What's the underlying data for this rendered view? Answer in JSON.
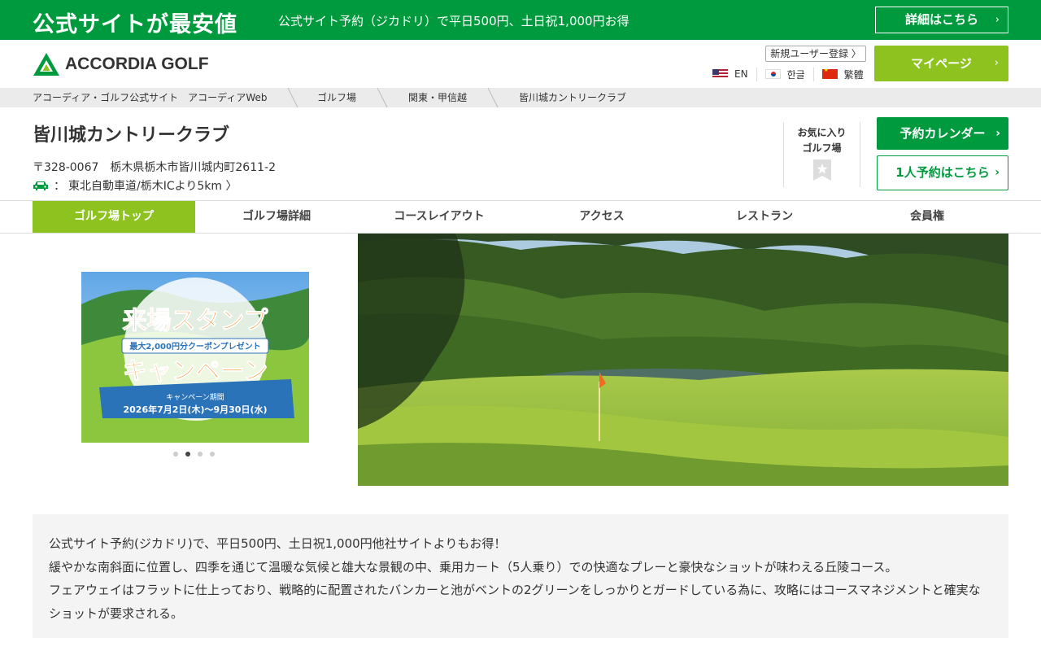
{
  "promo": {
    "title": "公式サイトが最安値",
    "text": "公式サイト予約（ジカドリ）で平日500円、土日祝1,000円お得",
    "details_button": "詳細はこちら"
  },
  "header": {
    "logo_text": "ACCORDIA GOLF",
    "register_button": "新規ユーザー登録 〉",
    "languages": [
      {
        "label": "EN",
        "flag": "us-flag-icon"
      },
      {
        "label": "한글",
        "flag": "kr-flag-icon"
      },
      {
        "label": "繁體",
        "flag": "cn-flag-icon"
      }
    ],
    "mypage_button": "マイページ"
  },
  "breadcrumb": [
    "アコーディア・ゴルフ公式サイト　アコーディアWeb",
    "ゴルフ場",
    "関東・甲信越",
    "皆川城カントリークラブ"
  ],
  "course": {
    "name": "皆川城カントリークラブ",
    "address": "〒328-0067　栃木県栃木市皆川城内町2611-2",
    "access_prefix": "：",
    "access_text": "東北自動車道/栃木ICより5km 〉",
    "favorite_line1": "お気に入り",
    "favorite_line2": "ゴルフ場",
    "calendar_button": "予約カレンダー",
    "solo_button": "1人予約はこちら"
  },
  "tabs": [
    "ゴルフ場トップ",
    "ゴルフ場詳細",
    "コースレイアウト",
    "アクセス",
    "レストラン",
    "会員権"
  ],
  "banner": {
    "title1": "来場スタンプ",
    "sub": "最大2,000円分クーポンプレゼント",
    "title2": "キャンペーン",
    "period_label": "キャンペーン期間",
    "period": "2026年7月2日(木)～9月30日(水)",
    "active_dot": 2,
    "dot_count": 4
  },
  "description": [
    "公式サイト予約(ジカドリ)で、平日500円、土日祝1,000円他社サイトよりもお得！",
    "緩やかな南斜面に位置し、四季を通じて温暖な気候と雄大な景観の中、乗用カート（5人乗り）での快適なプレーと豪快なショットが味わえる丘陵コース。",
    "フェアウェイはフラットに仕上っており、戦略的に配置されたバンカーと池がベントの2グリーンをしっかりとガードしている為に、攻略にはコースマネジメントと確実なショットが要求される。"
  ],
  "colors": {
    "brand_green": "#009a3e",
    "accent_lime": "#8dc21f",
    "breadcrumb_bg": "#ebebeb",
    "desc_bg": "#f4f4f4"
  }
}
